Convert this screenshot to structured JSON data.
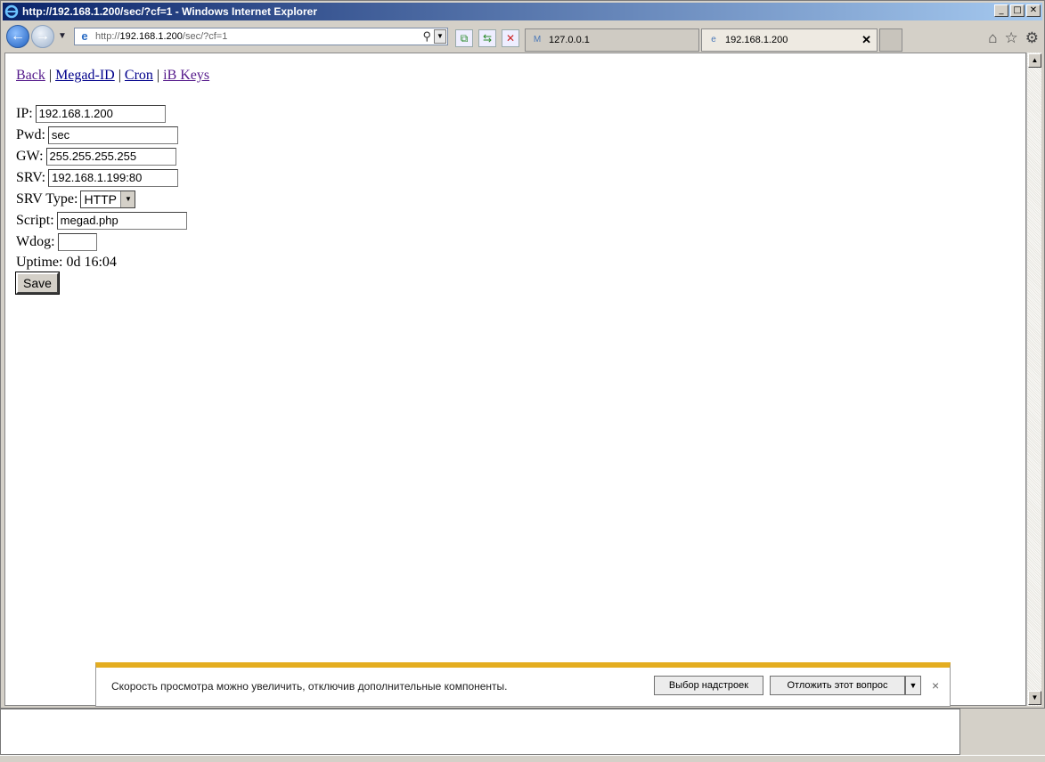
{
  "window": {
    "title": "http://192.168.1.200/sec/?cf=1 - Windows Internet Explorer",
    "minimize": "_",
    "maximize": "□",
    "close": "✕"
  },
  "address": {
    "prefix": "http://",
    "host": "192.168.1.200",
    "path": "/sec/?cf=1"
  },
  "tabs": [
    {
      "label": "127.0.0.1"
    },
    {
      "label": "192.168.1.200",
      "close": "✕"
    }
  ],
  "links": {
    "back": "Back",
    "megad_id": "Megad-ID",
    "cron": "Cron",
    "ib_keys": "iB Keys",
    "sep": "|"
  },
  "form": {
    "ip_label": "IP:",
    "ip_value": "192.168.1.200",
    "pwd_label": "Pwd:",
    "pwd_value": "sec",
    "gw_label": "GW:",
    "gw_value": "255.255.255.255",
    "srv_label": "SRV:",
    "srv_value": "192.168.1.199:80",
    "srv_type_label": "SRV Type:",
    "srv_type_value": "HTTP",
    "script_label": "Script:",
    "script_value": "megad.php",
    "wdog_label": "Wdog:",
    "wdog_value": "",
    "uptime_label": "Uptime:",
    "uptime_value": "0d 16:04",
    "save_label": "Save"
  },
  "notification": {
    "message": "Скорость просмотра можно увеличить, отключив дополнительные компоненты.",
    "choose_addons": "Выбор надстроек",
    "postpone": "Отложить этот вопрос",
    "close": "×"
  }
}
